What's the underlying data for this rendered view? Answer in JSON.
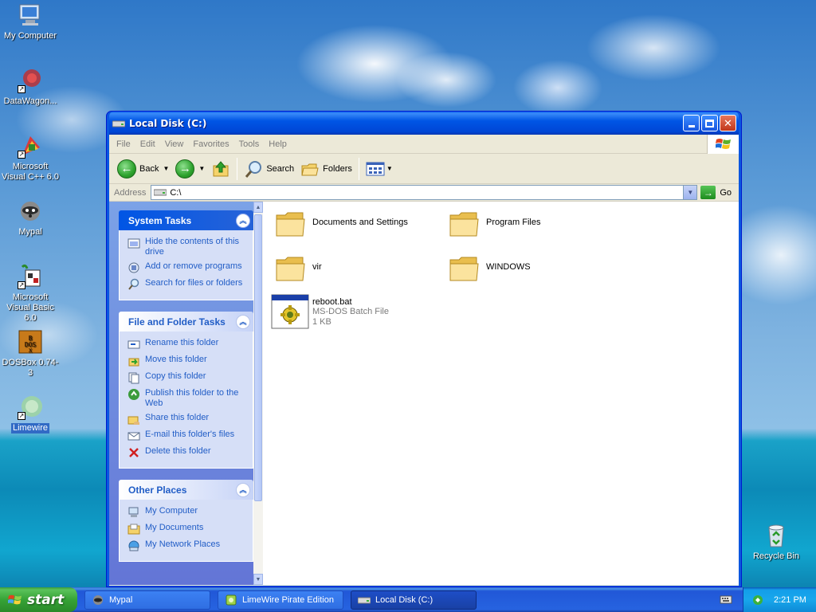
{
  "desktop": {
    "icons": [
      {
        "label": "My Computer",
        "icon": "computer-icon"
      },
      {
        "label": "DataWagon...",
        "icon": "datawagon-icon"
      },
      {
        "label": "Microsoft Visual C++ 6.0",
        "icon": "visual-cpp-icon"
      },
      {
        "label": "Mypal",
        "icon": "mypal-icon"
      },
      {
        "label": "Microsoft Visual Basic 6.0",
        "icon": "visual-basic-icon"
      },
      {
        "label": "DOSBox 0.74-3",
        "icon": "dosbox-icon"
      },
      {
        "label": "Limewire",
        "icon": "limewire-icon"
      },
      {
        "label": "Recycle Bin",
        "icon": "recycle-bin-icon"
      }
    ]
  },
  "window": {
    "title": "Local Disk (C:)",
    "menu": [
      "File",
      "Edit",
      "View",
      "Favorites",
      "Tools",
      "Help"
    ],
    "toolbar": {
      "back": "Back",
      "search": "Search",
      "folders": "Folders"
    },
    "address": {
      "label": "Address",
      "value": "C:\\",
      "go": "Go"
    }
  },
  "taskpane": {
    "system_tasks": {
      "title": "System Tasks",
      "items": [
        {
          "label": "Hide the contents of this drive",
          "icon": "hide-drive-icon"
        },
        {
          "label": "Add or remove programs",
          "icon": "add-remove-icon"
        },
        {
          "label": "Search for files or folders",
          "icon": "search-icon"
        }
      ]
    },
    "file_folder_tasks": {
      "title": "File and Folder Tasks",
      "items": [
        {
          "label": "Rename this folder",
          "icon": "rename-icon"
        },
        {
          "label": "Move this folder",
          "icon": "move-icon"
        },
        {
          "label": "Copy this folder",
          "icon": "copy-icon"
        },
        {
          "label": "Publish this folder to the Web",
          "icon": "publish-icon"
        },
        {
          "label": "Share this folder",
          "icon": "share-icon"
        },
        {
          "label": "E-mail this folder's files",
          "icon": "email-icon"
        },
        {
          "label": "Delete this folder",
          "icon": "delete-icon"
        }
      ]
    },
    "other_places": {
      "title": "Other Places",
      "items": [
        {
          "label": "My Computer",
          "icon": "computer-icon"
        },
        {
          "label": "My Documents",
          "icon": "documents-icon"
        },
        {
          "label": "My Network Places",
          "icon": "network-icon"
        }
      ]
    }
  },
  "files": [
    {
      "name": "Documents and Settings",
      "type": "folder"
    },
    {
      "name": "Program Files",
      "type": "folder"
    },
    {
      "name": "vir",
      "type": "folder"
    },
    {
      "name": "WINDOWS",
      "type": "folder"
    },
    {
      "name": "reboot.bat",
      "type": "batch",
      "kind": "MS-DOS Batch File",
      "size": "1 KB"
    }
  ],
  "taskbar": {
    "start": "start",
    "tasks": [
      {
        "label": "Mypal",
        "active": false
      },
      {
        "label": "LimeWire Pirate Edition",
        "active": false
      },
      {
        "label": "Local Disk (C:)",
        "active": true
      }
    ],
    "clock": "2:21 PM"
  },
  "colors": {
    "xp_blue": "#0055e5",
    "taskpane_link": "#215dc6",
    "start_green": "#36a336"
  }
}
